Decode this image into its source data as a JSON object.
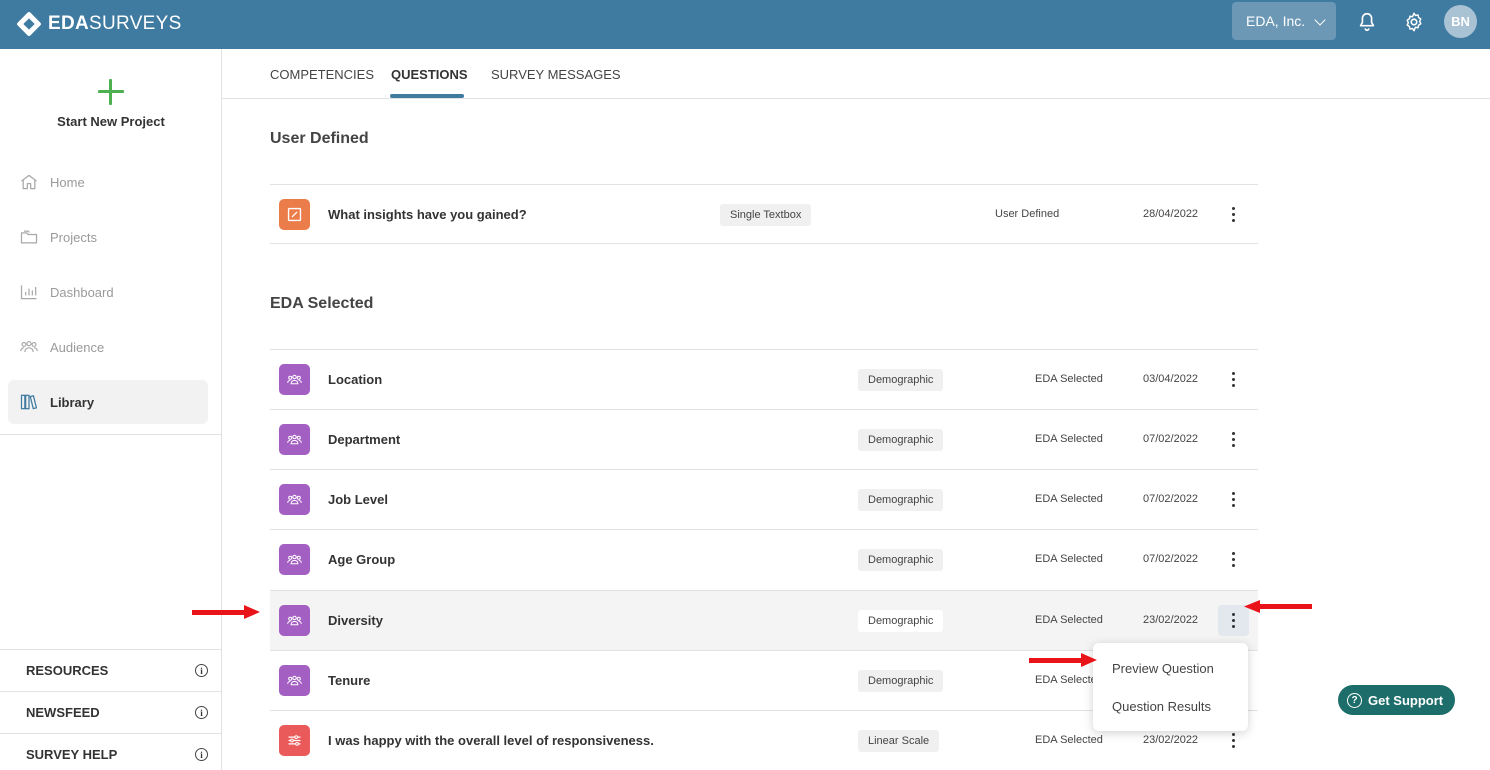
{
  "brand": {
    "name_bold": "EDA",
    "name_light": "SURVEYS"
  },
  "header": {
    "org": "EDA, Inc.",
    "avatar_initials": "BN"
  },
  "sidebar": {
    "new_project": "Start New Project",
    "items": [
      {
        "label": "Home",
        "icon": "home-icon"
      },
      {
        "label": "Projects",
        "icon": "folder-icon"
      },
      {
        "label": "Dashboard",
        "icon": "chart-icon"
      },
      {
        "label": "Audience",
        "icon": "people-icon"
      },
      {
        "label": "Library",
        "icon": "library-icon",
        "active": true
      }
    ],
    "links": [
      "RESOURCES",
      "NEWSFEED",
      "SURVEY HELP"
    ]
  },
  "tabs": [
    "COMPETENCIES",
    "QUESTIONS",
    "SURVEY MESSAGES"
  ],
  "sections": {
    "user_defined": {
      "title": "User Defined",
      "rows": [
        {
          "text": "What insights have you gained?",
          "type": "Single Textbox",
          "source": "User Defined",
          "date": "28/04/2022"
        }
      ]
    },
    "eda_selected": {
      "title": "EDA Selected",
      "rows": [
        {
          "text": "Location",
          "type": "Demographic",
          "source": "EDA Selected",
          "date": "03/04/2022"
        },
        {
          "text": "Department",
          "type": "Demographic",
          "source": "EDA Selected",
          "date": "07/02/2022"
        },
        {
          "text": "Job Level",
          "type": "Demographic",
          "source": "EDA Selected",
          "date": "07/02/2022"
        },
        {
          "text": "Age Group",
          "type": "Demographic",
          "source": "EDA Selected",
          "date": "07/02/2022"
        },
        {
          "text": "Diversity",
          "type": "Demographic",
          "source": "EDA Selected",
          "date": "23/02/2022"
        },
        {
          "text": "Tenure",
          "type": "Demographic",
          "source": "EDA Selecte",
          "date": ""
        },
        {
          "text": "I was happy with the overall level of responsiveness.",
          "type": "Linear Scale",
          "source": "EDA Selected",
          "date": "23/02/2022"
        }
      ]
    }
  },
  "context_menu": [
    "Preview Question",
    "Question Results"
  ],
  "support": {
    "label": "Get Support"
  },
  "colors": {
    "topbar": "#3f7aa0",
    "demographic": "#a35fc1",
    "textbox": "#eb7d4b",
    "scale": "#eb5a5a",
    "support": "#1d6e6a",
    "annotation_arrow": "#e8141a"
  }
}
